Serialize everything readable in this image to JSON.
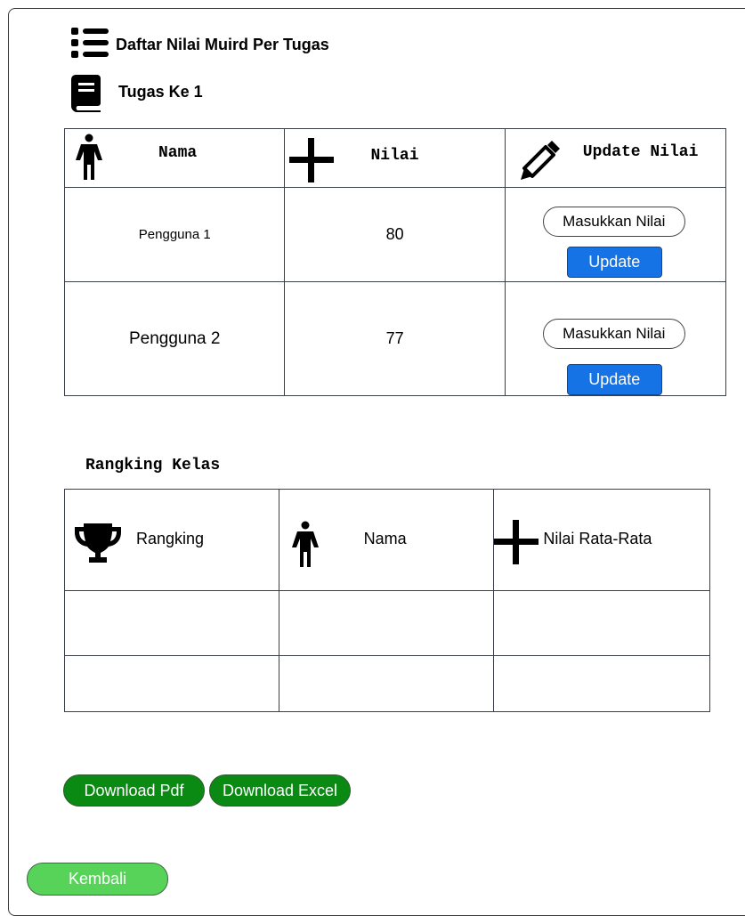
{
  "header": {
    "title": "Daftar Nilai Muird Per  Tugas",
    "title_icon": "list-icon",
    "subtitle": "Tugas Ke 1",
    "subtitle_icon": "book-icon"
  },
  "grades_table": {
    "columns": [
      {
        "label": "Nama",
        "icon": "person-icon"
      },
      {
        "label": "Nilai",
        "icon": "plus-icon"
      },
      {
        "label": "Update Nilai",
        "icon": "pencil-icon"
      }
    ],
    "rows": [
      {
        "name": "Pengguna 1",
        "score": "80",
        "input_placeholder": "Masukkan Nilai",
        "update_label": "Update"
      },
      {
        "name": "Pengguna 2",
        "score": "77",
        "input_placeholder": "Masukkan Nilai",
        "update_label": "Update"
      }
    ]
  },
  "ranking": {
    "title": "Rangking Kelas",
    "columns": [
      {
        "label": "Rangking",
        "icon": "trophy-icon"
      },
      {
        "label": "Nama",
        "icon": "person-icon"
      },
      {
        "label": "Nilai Rata-Rata",
        "icon": "plus-icon"
      }
    ]
  },
  "actions": {
    "download_pdf": "Download Pdf",
    "download_excel": "Download Excel",
    "back": "Kembali"
  },
  "colors": {
    "update_button": "#1673e6",
    "download_button": "#0a8a12",
    "back_button": "#58d35a"
  }
}
